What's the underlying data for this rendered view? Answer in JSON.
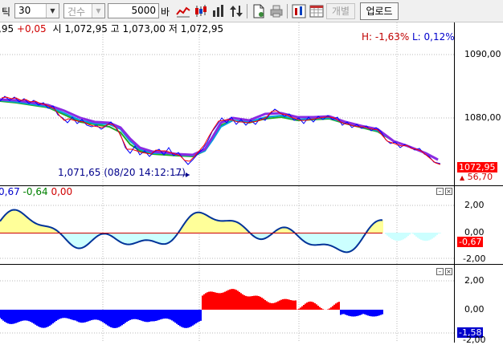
{
  "toolbar": {
    "period_label": "틱",
    "period_value": "30",
    "count_mode": "건수",
    "quantity": "5000",
    "quantity_unit": "바",
    "separate_button": "개별",
    "upload_button": "업로드"
  },
  "price_pane": {
    "info": {
      "current": ",95",
      "change": "+0,05",
      "open_label": "시",
      "open": "1,072,95",
      "high_label": "고",
      "high": "1,073,00",
      "low_label": "저",
      "low": "1,072,95"
    },
    "high_pct": "H: -1,63%",
    "low_pct": "L: 0,12%",
    "min_annotation": "1,071,65 (08/20 14:12:17)",
    "axis": [
      "1090,00",
      "1080,00"
    ],
    "last_price": "1072,95",
    "last_change": "56,70"
  },
  "oscillator_pane": {
    "values": [
      "0,67",
      "-0,64",
      "0,00"
    ],
    "axis": [
      "2,00",
      "0,00",
      "-2,00"
    ],
    "last_value": "-0,67"
  },
  "histogram_pane": {
    "axis": [
      "2,00",
      "0,00",
      "-2,00"
    ],
    "last_value": "-1,58"
  },
  "colors": {
    "price_up": "#ff0000",
    "price_down": "#0000ff",
    "ma_purple": "#8a2be2",
    "positive_fill": "#ffff99",
    "negative_fill": "#ccffff",
    "hist_up": "#ff0000",
    "hist_down": "#0000ff",
    "price_tag_bg": "#ff0000",
    "osc_tag_bg": "#ff0000",
    "hist_tag_bg": "#0000cc"
  }
}
